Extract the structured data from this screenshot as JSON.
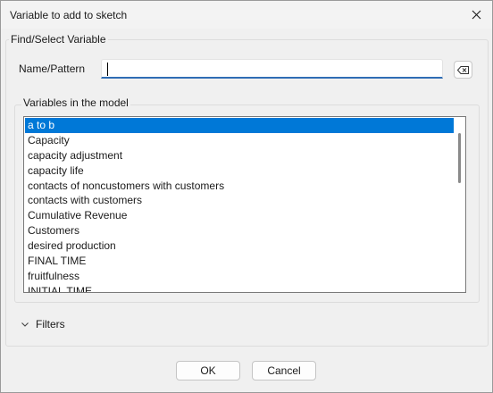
{
  "window": {
    "title": "Variable to add to sketch"
  },
  "find_group": {
    "legend": "Find/Select Variable",
    "name_label": "Name/Pattern",
    "name_value": ""
  },
  "variables": {
    "legend": "Variables in the model",
    "items": [
      {
        "label": "a to b",
        "selected": true
      },
      {
        "label": "Capacity"
      },
      {
        "label": "capacity adjustment"
      },
      {
        "label": "capacity life"
      },
      {
        "label": "contacts of noncustomers with customers"
      },
      {
        "label": "contacts with customers"
      },
      {
        "label": "Cumulative Revenue"
      },
      {
        "label": "Customers"
      },
      {
        "label": "desired production"
      },
      {
        "label": "FINAL TIME"
      },
      {
        "label": "fruitfulness"
      },
      {
        "label": "INITIAL TIME"
      }
    ]
  },
  "filters": {
    "label": "Filters",
    "icon": "chevron-down-icon"
  },
  "buttons": {
    "ok": "OK",
    "cancel": "Cancel"
  },
  "colors": {
    "selection": "#0078d7",
    "input_focus": "#2f6db5"
  }
}
